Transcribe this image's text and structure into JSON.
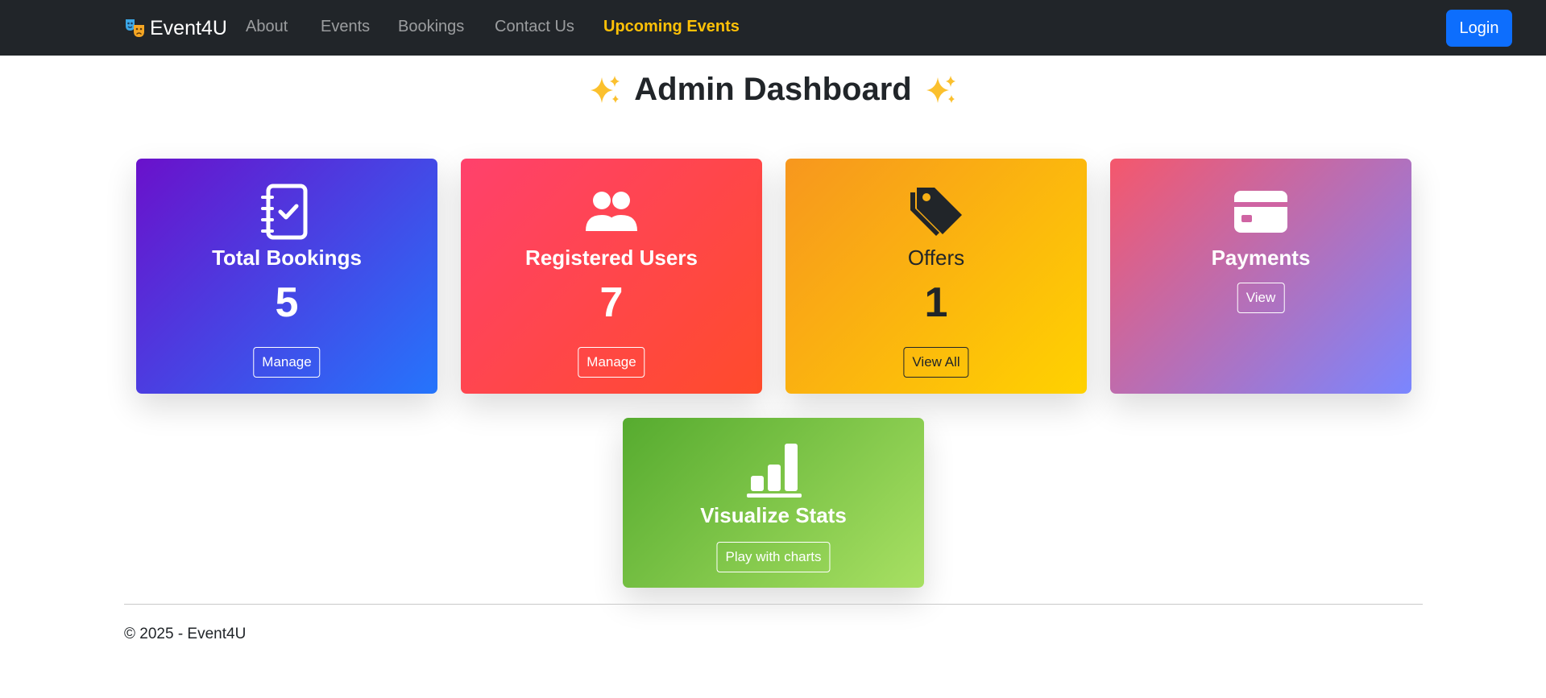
{
  "navbar": {
    "brand": "Event4U",
    "brand_icon": "theater-masks-icon",
    "links": [
      "About",
      "Events",
      "Bookings",
      "Contact Us"
    ],
    "highlight_link": "Upcoming Events",
    "login_label": "Login",
    "highlight_color": "#ffc107",
    "login_color": "#0d6efd"
  },
  "page": {
    "title": "Admin Dashboard",
    "title_decoration": "sparkles-icon"
  },
  "cards": {
    "bookings": {
      "title": "Total Bookings",
      "value": "5",
      "button": "Manage",
      "icon": "journal-check-icon"
    },
    "users": {
      "title": "Registered Users",
      "value": "7",
      "button": "Manage",
      "icon": "people-icon"
    },
    "offers": {
      "title": "Offers",
      "value": "1",
      "button": "View All",
      "icon": "tags-icon"
    },
    "payments": {
      "title": "Payments",
      "button": "View",
      "icon": "credit-card-icon"
    },
    "stats": {
      "title": "Visualize Stats",
      "button": "Play with charts",
      "icon": "bar-chart-icon"
    }
  },
  "footer": {
    "text": "© 2025 - Event4U"
  }
}
